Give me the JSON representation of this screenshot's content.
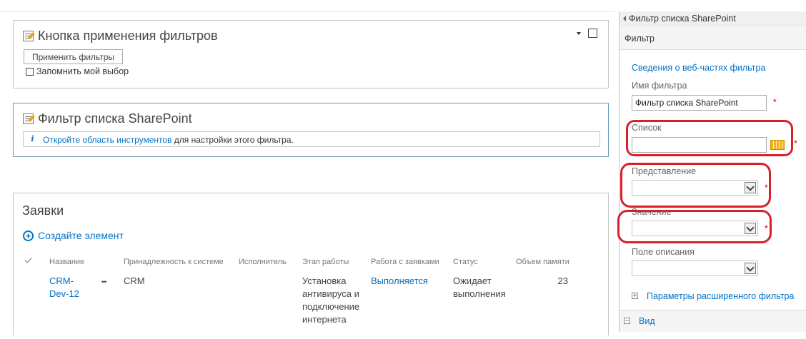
{
  "apply_webpart": {
    "title": "Кнопка применения фильтров",
    "apply_button": "Применить фильтры",
    "remember_label": "Запомнить мой выбор"
  },
  "sp_filter_webpart": {
    "title": "Фильтр списка SharePoint",
    "info_link": "Откройте область инструментов",
    "info_text": " для настройки этого фильтра."
  },
  "list_webpart": {
    "title": "Заявки",
    "new_item": "Создайте элемент",
    "columns": [
      "Название",
      "Принадлежность к системе",
      "Исполнитель",
      "Этап работы",
      "Работа с заявками",
      "Статус",
      "Объем памяти"
    ],
    "rows": [
      {
        "name_line1": "CRM-",
        "name_line2": "Dev-12",
        "ellipsis": "•••",
        "system": "CRM",
        "executor": "",
        "stage_lines": [
          "Установка",
          "антивируса и",
          "подключение",
          "интернета"
        ],
        "workflow": "Выполняется",
        "status_lines": [
          "Ожидает",
          "выполнения"
        ],
        "memory": "23"
      }
    ]
  },
  "tool_pane": {
    "header": "Фильтр списка SharePoint",
    "section": "Фильтр",
    "info_link": "Сведения о веб-частях фильтра",
    "filter_name_label": "Имя фильтра",
    "filter_name_value": "Фильтр списка SharePoint",
    "list_label": "Список",
    "list_value": "",
    "view_label": "Представление",
    "value_label": "Значение",
    "description_label": "Поле описания",
    "advanced_label": "Параметры расширенного фильтра",
    "view_section_label": "Вид",
    "required_mark": "*"
  },
  "colors": {
    "accent": "#0072c6",
    "highlight": "#d9202a",
    "required": "#bf0000",
    "list_picker": "#f1b31c"
  }
}
